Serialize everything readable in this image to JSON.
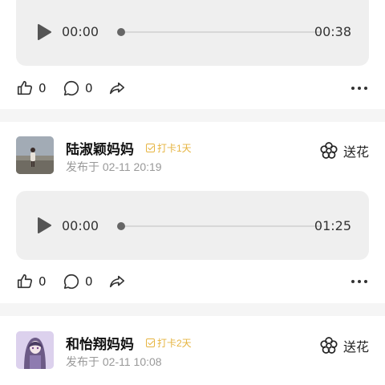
{
  "audio_1": {
    "current": "00:00",
    "duration": "00:38",
    "progress": 0
  },
  "actions_1": {
    "likes": "0",
    "comments": "0"
  },
  "posts": [
    {
      "name": "陆淑颖妈妈",
      "badge": "打卡1天",
      "date": "发布于 02-11 20:19",
      "flower_label": "送花",
      "audio": {
        "current": "00:00",
        "duration": "01:25",
        "progress": 0
      },
      "likes": "0",
      "comments": "0"
    },
    {
      "name": "和怡翔妈妈",
      "badge": "打卡2天",
      "date": "发布于 02-11 10:08",
      "flower_label": "送花"
    }
  ],
  "colors": {
    "badge": "#e6b440",
    "audio_bg": "#efefef",
    "separator": "#f5f5f5"
  },
  "icons": [
    "play-icon",
    "thumbs-up-icon",
    "comment-icon",
    "share-icon",
    "more-icon",
    "flower-icon",
    "check-icon"
  ]
}
